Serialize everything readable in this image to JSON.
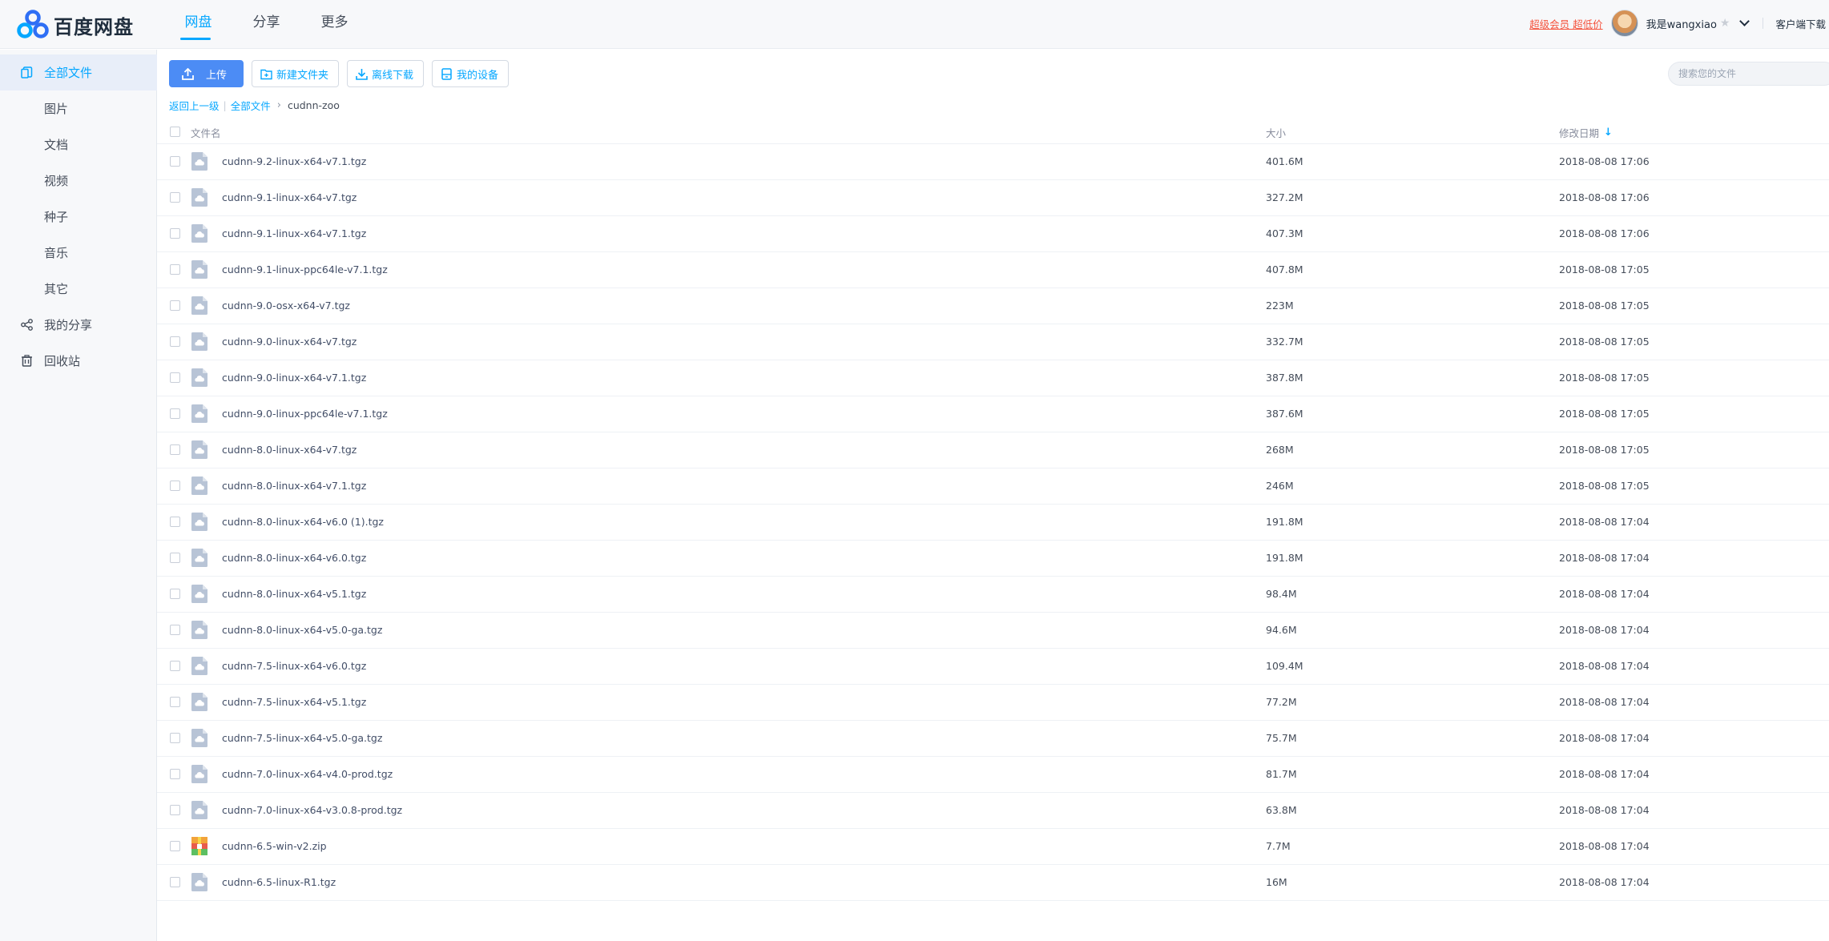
{
  "brand": {
    "name": "百度网盘"
  },
  "nav": [
    {
      "label": "网盘",
      "active": true
    },
    {
      "label": "分享",
      "active": false
    },
    {
      "label": "更多",
      "active": false
    }
  ],
  "header": {
    "vip_promo": "超级会员 超低价",
    "username": "我是wangxiao",
    "client_download": "客户端下载"
  },
  "sidebar": {
    "items": [
      {
        "label": "全部文件",
        "icon": "all-files-icon",
        "active": true
      },
      {
        "label": "图片"
      },
      {
        "label": "文档"
      },
      {
        "label": "视频"
      },
      {
        "label": "种子"
      },
      {
        "label": "音乐"
      },
      {
        "label": "其它"
      },
      {
        "label": "我的分享",
        "icon": "share-icon"
      },
      {
        "label": "回收站",
        "icon": "recycle-bin-icon"
      }
    ]
  },
  "toolbar": {
    "upload": "上传",
    "new_folder": "新建文件夹",
    "offline_download": "离线下载",
    "my_devices": "我的设备"
  },
  "search": {
    "placeholder": "搜索您的文件"
  },
  "breadcrumb": {
    "back": "返回上一级",
    "root": "全部文件",
    "current": "cudnn-zoo"
  },
  "table": {
    "headers": {
      "name": "文件名",
      "size": "大小",
      "date": "修改日期"
    },
    "sort_column": "date",
    "sort_direction": "desc",
    "rows": [
      {
        "name": "cudnn-9.2-linux-x64-v7.1.tgz",
        "size": "401.6M",
        "date": "2018-08-08 17:06",
        "type": "archive"
      },
      {
        "name": "cudnn-9.1-linux-x64-v7.tgz",
        "size": "327.2M",
        "date": "2018-08-08 17:06",
        "type": "archive"
      },
      {
        "name": "cudnn-9.1-linux-x64-v7.1.tgz",
        "size": "407.3M",
        "date": "2018-08-08 17:06",
        "type": "archive"
      },
      {
        "name": "cudnn-9.1-linux-ppc64le-v7.1.tgz",
        "size": "407.8M",
        "date": "2018-08-08 17:05",
        "type": "archive"
      },
      {
        "name": "cudnn-9.0-osx-x64-v7.tgz",
        "size": "223M",
        "date": "2018-08-08 17:05",
        "type": "archive"
      },
      {
        "name": "cudnn-9.0-linux-x64-v7.tgz",
        "size": "332.7M",
        "date": "2018-08-08 17:05",
        "type": "archive"
      },
      {
        "name": "cudnn-9.0-linux-x64-v7.1.tgz",
        "size": "387.8M",
        "date": "2018-08-08 17:05",
        "type": "archive"
      },
      {
        "name": "cudnn-9.0-linux-ppc64le-v7.1.tgz",
        "size": "387.6M",
        "date": "2018-08-08 17:05",
        "type": "archive"
      },
      {
        "name": "cudnn-8.0-linux-x64-v7.tgz",
        "size": "268M",
        "date": "2018-08-08 17:05",
        "type": "archive"
      },
      {
        "name": "cudnn-8.0-linux-x64-v7.1.tgz",
        "size": "246M",
        "date": "2018-08-08 17:05",
        "type": "archive"
      },
      {
        "name": "cudnn-8.0-linux-x64-v6.0 (1).tgz",
        "size": "191.8M",
        "date": "2018-08-08 17:04",
        "type": "archive"
      },
      {
        "name": "cudnn-8.0-linux-x64-v6.0.tgz",
        "size": "191.8M",
        "date": "2018-08-08 17:04",
        "type": "archive"
      },
      {
        "name": "cudnn-8.0-linux-x64-v5.1.tgz",
        "size": "98.4M",
        "date": "2018-08-08 17:04",
        "type": "archive"
      },
      {
        "name": "cudnn-8.0-linux-x64-v5.0-ga.tgz",
        "size": "94.6M",
        "date": "2018-08-08 17:04",
        "type": "archive"
      },
      {
        "name": "cudnn-7.5-linux-x64-v6.0.tgz",
        "size": "109.4M",
        "date": "2018-08-08 17:04",
        "type": "archive"
      },
      {
        "name": "cudnn-7.5-linux-x64-v5.1.tgz",
        "size": "77.2M",
        "date": "2018-08-08 17:04",
        "type": "archive"
      },
      {
        "name": "cudnn-7.5-linux-x64-v5.0-ga.tgz",
        "size": "75.7M",
        "date": "2018-08-08 17:04",
        "type": "archive"
      },
      {
        "name": "cudnn-7.0-linux-x64-v4.0-prod.tgz",
        "size": "81.7M",
        "date": "2018-08-08 17:04",
        "type": "archive"
      },
      {
        "name": "cudnn-7.0-linux-x64-v3.0.8-prod.tgz",
        "size": "63.8M",
        "date": "2018-08-08 17:04",
        "type": "archive"
      },
      {
        "name": "cudnn-6.5-win-v2.zip",
        "size": "7.7M",
        "date": "2018-08-08 17:04",
        "type": "zip"
      },
      {
        "name": "cudnn-6.5-linux-R1.tgz",
        "size": "16M",
        "date": "2018-08-08 17:04",
        "type": "archive"
      }
    ]
  },
  "colors": {
    "accent": "#06a7ff",
    "primary_button": "#4c8cf5",
    "vip_red": "#f5533d",
    "sidebar_bg": "#f7f8fa",
    "file_icon": "#b8c4d6"
  }
}
